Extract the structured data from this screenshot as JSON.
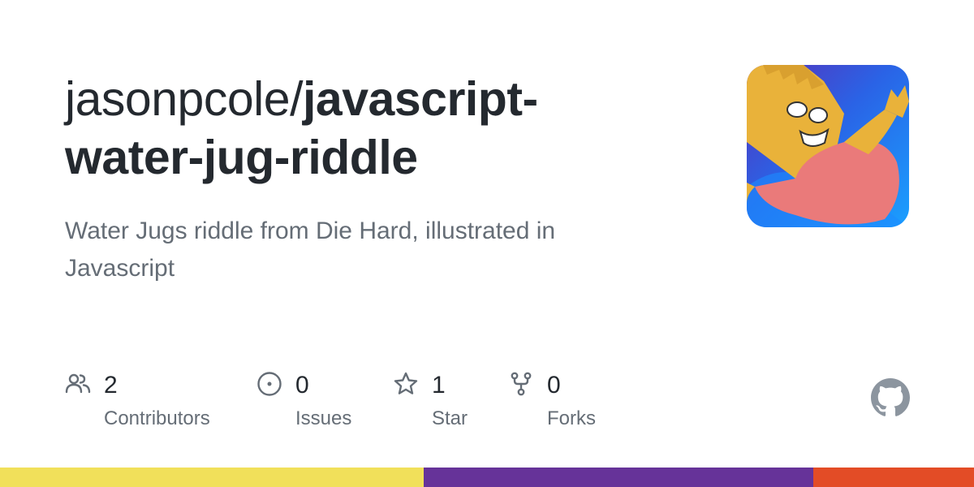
{
  "repo": {
    "owner": "jasonpcole/",
    "name": "javascript-water-jug-riddle",
    "description": "Water Jugs riddle from Die Hard, illustrated in Javascript"
  },
  "stats": [
    {
      "icon": "contributors-icon",
      "value": "2",
      "label": "Contributors"
    },
    {
      "icon": "issues-icon",
      "value": "0",
      "label": "Issues"
    },
    {
      "icon": "star-icon",
      "value": "1",
      "label": "Star"
    },
    {
      "icon": "fork-icon",
      "value": "0",
      "label": "Forks"
    }
  ],
  "language_bar": [
    {
      "color": "#f1e05a",
      "share": 0.435
    },
    {
      "color": "#663399",
      "share": 0.4
    },
    {
      "color": "#e34c26",
      "share": 0.165
    }
  ],
  "colors": {
    "text": "#24292f",
    "muted": "#656d76",
    "logo": "#8c959f"
  }
}
